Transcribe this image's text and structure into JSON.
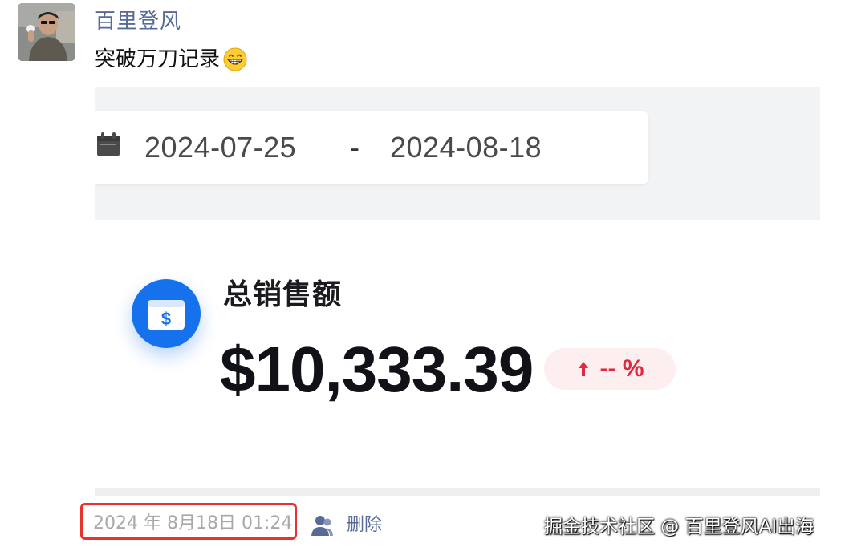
{
  "post": {
    "username": "百里登风",
    "text": "突破万刀记录",
    "emoji": "grinning-face-icon"
  },
  "screenshot": {
    "date_range": {
      "start": "2024-07-25",
      "separator": "-",
      "end": "2024-08-18"
    },
    "metric": {
      "label": "总销售额",
      "value": "$10,333.39",
      "change_text": "-- %",
      "change_direction": "up"
    },
    "colors": {
      "accent": "#1672ec",
      "change_text": "#e0293f",
      "change_bg": "#fdeef0"
    }
  },
  "footer": {
    "timestamp": "2024 年 8月18日 01:24",
    "delete_label": "删除",
    "watermark": "掘金技术社区 @ 百里登风AI出海"
  },
  "colors": {
    "username": "#576b95",
    "highlight_border": "#e8332c"
  }
}
